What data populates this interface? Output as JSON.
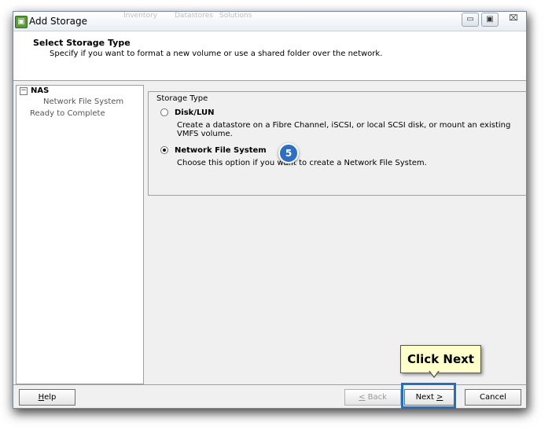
{
  "window": {
    "title": "Add Storage",
    "background_title_fragments": [
      "Inventory",
      "Datastores",
      "Solutions"
    ]
  },
  "controls": {
    "minimize": "▭",
    "restore": "▣",
    "close": "⌧"
  },
  "header": {
    "title": "Select Storage Type",
    "subtitle": "Specify if you want to format a new volume or use a shared folder over the network."
  },
  "steps": {
    "group": "NAS",
    "items": [
      "Network File System",
      "Ready to Complete"
    ]
  },
  "storage_type": {
    "group_label": "Storage Type",
    "options": [
      {
        "label": "Disk/LUN",
        "description": "Create a datastore on a Fibre Channel, iSCSI, or local SCSI disk, or mount an existing VMFS volume.",
        "selected": false
      },
      {
        "label": "Network File System",
        "description": "Choose this option if you want to create a Network File System.",
        "selected": true
      }
    ]
  },
  "annotation": {
    "step_number": "5",
    "callout": "Click Next"
  },
  "buttons": {
    "help": {
      "prefix": "",
      "mnemonic": "H",
      "rest": "elp"
    },
    "back": {
      "prefix": "",
      "mnemonic": "<",
      "rest": " Back"
    },
    "next": {
      "prefix": "Next ",
      "mnemonic": ">",
      "rest": ""
    },
    "cancel": "Cancel"
  },
  "colors": {
    "highlight": "#1f6fc6",
    "callout_bg": "#ffffcc",
    "badge": "#2d6fc4"
  }
}
